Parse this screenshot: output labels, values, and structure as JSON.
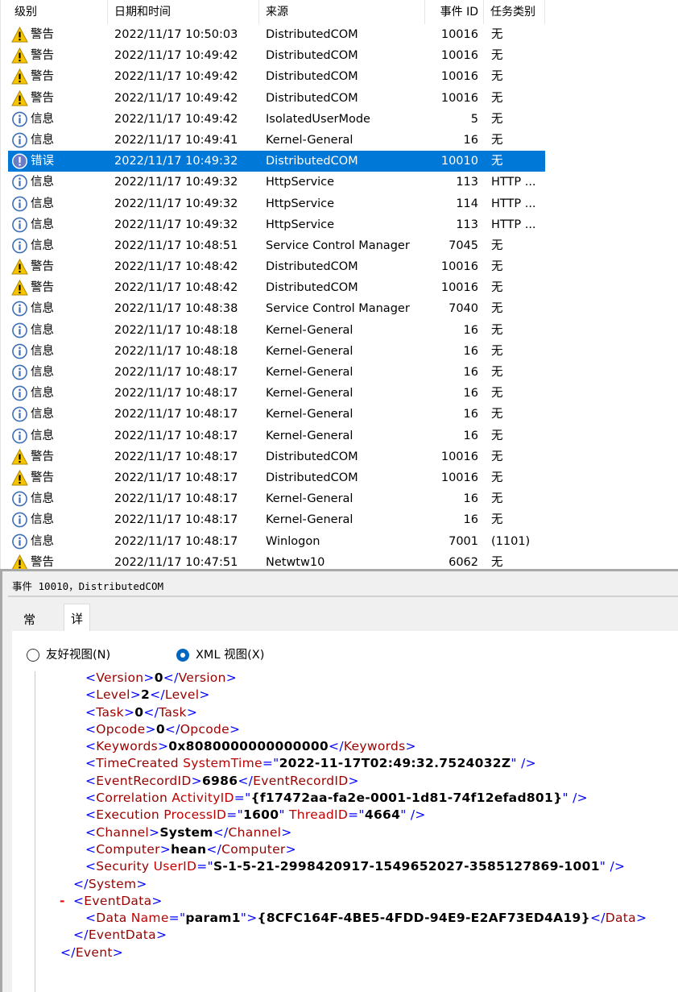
{
  "list": {
    "columns": {
      "level": "级别",
      "datetime": "日期和时间",
      "source": "来源",
      "event_id": "事件 ID",
      "task_category": "任务类别"
    },
    "rows": [
      {
        "level": "警告",
        "icon": "warning-icon",
        "datetime": "2022/11/17 10:50:03",
        "source": "DistributedCOM",
        "event_id": "10016",
        "task": "无"
      },
      {
        "level": "警告",
        "icon": "warning-icon",
        "datetime": "2022/11/17 10:49:42",
        "source": "DistributedCOM",
        "event_id": "10016",
        "task": "无"
      },
      {
        "level": "警告",
        "icon": "warning-icon",
        "datetime": "2022/11/17 10:49:42",
        "source": "DistributedCOM",
        "event_id": "10016",
        "task": "无"
      },
      {
        "level": "警告",
        "icon": "warning-icon",
        "datetime": "2022/11/17 10:49:42",
        "source": "DistributedCOM",
        "event_id": "10016",
        "task": "无"
      },
      {
        "level": "信息",
        "icon": "info-icon",
        "datetime": "2022/11/17 10:49:42",
        "source": "IsolatedUserMode",
        "event_id": "5",
        "task": "无"
      },
      {
        "level": "信息",
        "icon": "info-icon",
        "datetime": "2022/11/17 10:49:41",
        "source": "Kernel-General",
        "event_id": "16",
        "task": "无"
      },
      {
        "level": "错误",
        "icon": "error-icon",
        "datetime": "2022/11/17 10:49:32",
        "source": "DistributedCOM",
        "event_id": "10010",
        "task": "无",
        "selected": true
      },
      {
        "level": "信息",
        "icon": "info-icon",
        "datetime": "2022/11/17 10:49:32",
        "source": "HttpService",
        "event_id": "113",
        "task": "HTTP ..."
      },
      {
        "level": "信息",
        "icon": "info-icon",
        "datetime": "2022/11/17 10:49:32",
        "source": "HttpService",
        "event_id": "114",
        "task": "HTTP ..."
      },
      {
        "level": "信息",
        "icon": "info-icon",
        "datetime": "2022/11/17 10:49:32",
        "source": "HttpService",
        "event_id": "113",
        "task": "HTTP ..."
      },
      {
        "level": "信息",
        "icon": "info-icon",
        "datetime": "2022/11/17 10:48:51",
        "source": "Service Control Manager",
        "event_id": "7045",
        "task": "无"
      },
      {
        "level": "警告",
        "icon": "warning-icon",
        "datetime": "2022/11/17 10:48:42",
        "source": "DistributedCOM",
        "event_id": "10016",
        "task": "无"
      },
      {
        "level": "警告",
        "icon": "warning-icon",
        "datetime": "2022/11/17 10:48:42",
        "source": "DistributedCOM",
        "event_id": "10016",
        "task": "无"
      },
      {
        "level": "信息",
        "icon": "info-icon",
        "datetime": "2022/11/17 10:48:38",
        "source": "Service Control Manager",
        "event_id": "7040",
        "task": "无"
      },
      {
        "level": "信息",
        "icon": "info-icon",
        "datetime": "2022/11/17 10:48:18",
        "source": "Kernel-General",
        "event_id": "16",
        "task": "无"
      },
      {
        "level": "信息",
        "icon": "info-icon",
        "datetime": "2022/11/17 10:48:18",
        "source": "Kernel-General",
        "event_id": "16",
        "task": "无"
      },
      {
        "level": "信息",
        "icon": "info-icon",
        "datetime": "2022/11/17 10:48:17",
        "source": "Kernel-General",
        "event_id": "16",
        "task": "无"
      },
      {
        "level": "信息",
        "icon": "info-icon",
        "datetime": "2022/11/17 10:48:17",
        "source": "Kernel-General",
        "event_id": "16",
        "task": "无"
      },
      {
        "level": "信息",
        "icon": "info-icon",
        "datetime": "2022/11/17 10:48:17",
        "source": "Kernel-General",
        "event_id": "16",
        "task": "无"
      },
      {
        "level": "信息",
        "icon": "info-icon",
        "datetime": "2022/11/17 10:48:17",
        "source": "Kernel-General",
        "event_id": "16",
        "task": "无"
      },
      {
        "level": "警告",
        "icon": "warning-icon",
        "datetime": "2022/11/17 10:48:17",
        "source": "DistributedCOM",
        "event_id": "10016",
        "task": "无"
      },
      {
        "level": "警告",
        "icon": "warning-icon",
        "datetime": "2022/11/17 10:48:17",
        "source": "DistributedCOM",
        "event_id": "10016",
        "task": "无"
      },
      {
        "level": "信息",
        "icon": "info-icon",
        "datetime": "2022/11/17 10:48:17",
        "source": "Kernel-General",
        "event_id": "16",
        "task": "无"
      },
      {
        "level": "信息",
        "icon": "info-icon",
        "datetime": "2022/11/17 10:48:17",
        "source": "Kernel-General",
        "event_id": "16",
        "task": "无"
      },
      {
        "level": "信息",
        "icon": "info-icon",
        "datetime": "2022/11/17 10:48:17",
        "source": "Winlogon",
        "event_id": "7001",
        "task": "(1101)"
      },
      {
        "level": "警告",
        "icon": "warning-icon",
        "datetime": "2022/11/17 10:47:51",
        "source": "Netwtw10",
        "event_id": "6062",
        "task": "无"
      }
    ]
  },
  "details": {
    "title": "事件 10010，DistributedCOM",
    "tabs": [
      {
        "label": "常规",
        "active": false
      },
      {
        "label": "详细信息",
        "active": true
      }
    ],
    "view_options": [
      {
        "label": "友好视图(N)",
        "selected": false
      },
      {
        "label": "XML 视图(X)",
        "selected": true
      }
    ],
    "xml_lines": [
      [
        {
          "c": "b",
          "t": "<"
        },
        {
          "c": "t",
          "t": "Version"
        },
        {
          "c": "b",
          "t": ">"
        },
        {
          "c": "v",
          "t": "0"
        },
        {
          "c": "b",
          "t": "</"
        },
        {
          "c": "t",
          "t": "Version"
        },
        {
          "c": "b",
          "t": ">"
        }
      ],
      [
        {
          "c": "b",
          "t": "<"
        },
        {
          "c": "t",
          "t": "Level"
        },
        {
          "c": "b",
          "t": ">"
        },
        {
          "c": "v",
          "t": "2"
        },
        {
          "c": "b",
          "t": "</"
        },
        {
          "c": "t",
          "t": "Level"
        },
        {
          "c": "b",
          "t": ">"
        }
      ],
      [
        {
          "c": "b",
          "t": "<"
        },
        {
          "c": "t",
          "t": "Task"
        },
        {
          "c": "b",
          "t": ">"
        },
        {
          "c": "v",
          "t": "0"
        },
        {
          "c": "b",
          "t": "</"
        },
        {
          "c": "t",
          "t": "Task"
        },
        {
          "c": "b",
          "t": ">"
        }
      ],
      [
        {
          "c": "b",
          "t": "<"
        },
        {
          "c": "t",
          "t": "Opcode"
        },
        {
          "c": "b",
          "t": ">"
        },
        {
          "c": "v",
          "t": "0"
        },
        {
          "c": "b",
          "t": "</"
        },
        {
          "c": "t",
          "t": "Opcode"
        },
        {
          "c": "b",
          "t": ">"
        }
      ],
      [
        {
          "c": "b",
          "t": "<"
        },
        {
          "c": "t",
          "t": "Keywords"
        },
        {
          "c": "b",
          "t": ">"
        },
        {
          "c": "v",
          "t": "0x8080000000000000"
        },
        {
          "c": "b",
          "t": "</"
        },
        {
          "c": "t",
          "t": "Keywords"
        },
        {
          "c": "b",
          "t": ">"
        }
      ],
      [
        {
          "c": "b",
          "t": "<"
        },
        {
          "c": "t",
          "t": "TimeCreated"
        },
        {
          "c": "an",
          "t": " SystemTime"
        },
        {
          "c": "b",
          "t": "=\""
        },
        {
          "c": "v",
          "t": "2022-11-17T02:49:32.7524032Z"
        },
        {
          "c": "b",
          "t": "\" />"
        }
      ],
      [
        {
          "c": "b",
          "t": "<"
        },
        {
          "c": "t",
          "t": "EventRecordID"
        },
        {
          "c": "b",
          "t": ">"
        },
        {
          "c": "v",
          "t": "6986"
        },
        {
          "c": "b",
          "t": "</"
        },
        {
          "c": "t",
          "t": "EventRecordID"
        },
        {
          "c": "b",
          "t": ">"
        }
      ],
      [
        {
          "c": "b",
          "t": "<"
        },
        {
          "c": "t",
          "t": "Correlation"
        },
        {
          "c": "an",
          "t": " ActivityID"
        },
        {
          "c": "b",
          "t": "=\""
        },
        {
          "c": "v",
          "t": "{f17472aa-fa2e-0001-1d81-74f12efad801}"
        },
        {
          "c": "b",
          "t": "\" />"
        }
      ],
      [
        {
          "c": "b",
          "t": "<"
        },
        {
          "c": "t",
          "t": "Execution"
        },
        {
          "c": "an",
          "t": " ProcessID"
        },
        {
          "c": "b",
          "t": "=\""
        },
        {
          "c": "v",
          "t": "1600"
        },
        {
          "c": "b",
          "t": "\""
        },
        {
          "c": "an",
          "t": " ThreadID"
        },
        {
          "c": "b",
          "t": "=\""
        },
        {
          "c": "v",
          "t": "4664"
        },
        {
          "c": "b",
          "t": "\" />"
        }
      ],
      [
        {
          "c": "b",
          "t": "<"
        },
        {
          "c": "t",
          "t": "Channel"
        },
        {
          "c": "b",
          "t": ">"
        },
        {
          "c": "v",
          "t": "System"
        },
        {
          "c": "b",
          "t": "</"
        },
        {
          "c": "t",
          "t": "Channel"
        },
        {
          "c": "b",
          "t": ">"
        }
      ],
      [
        {
          "c": "b",
          "t": "<"
        },
        {
          "c": "t",
          "t": "Computer"
        },
        {
          "c": "b",
          "t": ">"
        },
        {
          "c": "v",
          "t": "hean"
        },
        {
          "c": "b",
          "t": "</"
        },
        {
          "c": "t",
          "t": "Computer"
        },
        {
          "c": "b",
          "t": ">"
        }
      ],
      [
        {
          "c": "b",
          "t": "<"
        },
        {
          "c": "t",
          "t": "Security"
        },
        {
          "c": "an",
          "t": " UserID"
        },
        {
          "c": "b",
          "t": "=\""
        },
        {
          "c": "v",
          "t": "S-1-5-21-2998420917-1549652027-3585127869-1001"
        },
        {
          "c": "b",
          "t": "\" />"
        }
      ],
      [
        {
          "c": "b",
          "t": "</"
        },
        {
          "c": "t",
          "t": "System"
        },
        {
          "c": "b",
          "t": ">"
        }
      ],
      [
        {
          "c": "b",
          "t": "<"
        },
        {
          "c": "t",
          "t": "EventData"
        },
        {
          "c": "b",
          "t": ">"
        }
      ],
      [
        {
          "c": "b",
          "t": "<"
        },
        {
          "c": "t",
          "t": "Data"
        },
        {
          "c": "an",
          "t": " Name"
        },
        {
          "c": "b",
          "t": "=\""
        },
        {
          "c": "v",
          "t": "param1"
        },
        {
          "c": "b",
          "t": "\">"
        },
        {
          "c": "v",
          "t": "{8CFC164F-4BE5-4FDD-94E9-E2AF73ED4A19}"
        },
        {
          "c": "b",
          "t": "</"
        },
        {
          "c": "t",
          "t": "Data"
        },
        {
          "c": "b",
          "t": ">"
        }
      ],
      [
        {
          "c": "b",
          "t": "</"
        },
        {
          "c": "t",
          "t": "EventData"
        },
        {
          "c": "b",
          "t": ">"
        }
      ],
      [
        {
          "c": "b",
          "t": "</"
        },
        {
          "c": "t",
          "t": "Event"
        },
        {
          "c": "b",
          "t": ">"
        }
      ]
    ],
    "collapse_marker": "-"
  },
  "colors": {
    "selection": "#0078d7",
    "xml_bracket": "#0000ff",
    "xml_tag": "#990000",
    "xml_attr": "#c00000"
  }
}
